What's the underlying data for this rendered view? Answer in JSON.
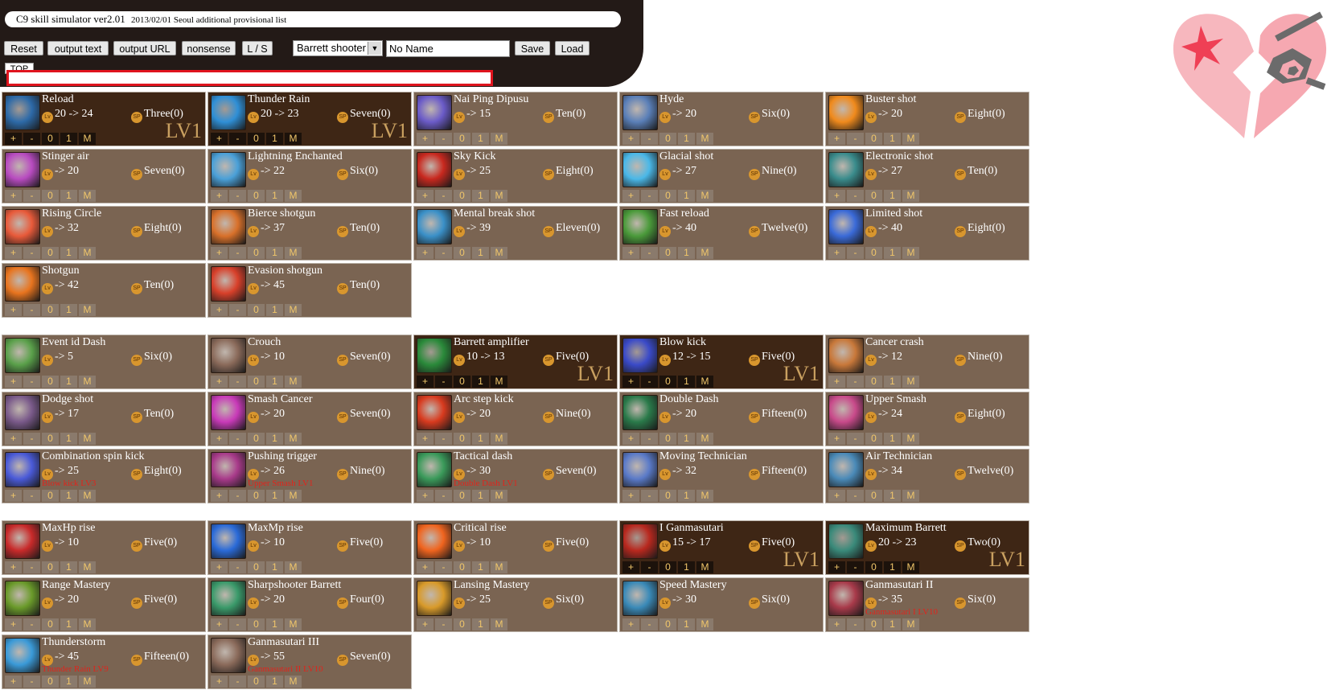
{
  "header": {
    "title": "C9 skill simulator ver2.01",
    "subtitle": "2013/02/01 Seoul additional provisional list",
    "buttons": [
      "Reset",
      "output text",
      "output URL",
      "nonsense",
      "L / S"
    ],
    "character_select": "Barrett shooter",
    "name_input": "No Name",
    "save_label": "Save",
    "load_label": "Load",
    "top_label": "TOP",
    "url_value": ""
  },
  "labels": {
    "lv_badge": "Lv",
    "sp_badge": "SP",
    "learned_marker": "LV1",
    "controls": [
      "+",
      "-",
      "0",
      "1",
      "M"
    ]
  },
  "colors": {
    "card_bg": "#7a6452",
    "card_learned_bg": "#3e2615",
    "header_bg": "#231a17",
    "prereq": "#e0241c",
    "control_text": "#f0c66a"
  },
  "skills": [
    {
      "name": "Reload",
      "level": "20 -> 24",
      "sp": "Three(0)",
      "learned": true,
      "prereq": "",
      "icon": "#2d6aa8"
    },
    {
      "name": "Thunder Rain",
      "level": "20 -> 23",
      "sp": "Seven(0)",
      "learned": true,
      "prereq": "",
      "icon": "#2f8fd6"
    },
    {
      "name": "Nai Ping Dipusu",
      "level": "-> 15",
      "sp": "Ten(0)",
      "learned": false,
      "prereq": "",
      "icon": "#6b5bc8"
    },
    {
      "name": "Hyde",
      "level": "-> 20",
      "sp": "Six(0)",
      "learned": false,
      "prereq": "",
      "icon": "#5a7fb8"
    },
    {
      "name": "Buster shot",
      "level": "-> 20",
      "sp": "Eight(0)",
      "learned": false,
      "prereq": "",
      "icon": "#f08a1c"
    },
    {
      "name": "Stinger air",
      "level": "-> 20",
      "sp": "Seven(0)",
      "learned": false,
      "prereq": "",
      "icon": "#b84bc0"
    },
    {
      "name": "Lightning Enchanted",
      "level": "-> 22",
      "sp": "Six(0)",
      "learned": false,
      "prereq": "",
      "icon": "#4aa0d8"
    },
    {
      "name": "Sky Kick",
      "level": "-> 25",
      "sp": "Eight(0)",
      "learned": false,
      "prereq": "",
      "icon": "#c8281e"
    },
    {
      "name": "Glacial shot",
      "level": "-> 27",
      "sp": "Nine(0)",
      "learned": false,
      "prereq": "",
      "icon": "#4ab8e8"
    },
    {
      "name": "Electronic shot",
      "level": "-> 27",
      "sp": "Ten(0)",
      "learned": false,
      "prereq": "",
      "icon": "#3a8c8c"
    },
    {
      "name": "Rising Circle",
      "level": "-> 32",
      "sp": "Eight(0)",
      "learned": false,
      "prereq": "",
      "icon": "#e85a3a"
    },
    {
      "name": "Bierce shotgun",
      "level": "-> 37",
      "sp": "Ten(0)",
      "learned": false,
      "prereq": "",
      "icon": "#d8702a"
    },
    {
      "name": "Mental break shot",
      "level": "-> 39",
      "sp": "Eleven(0)",
      "learned": false,
      "prereq": "",
      "icon": "#3a90c8"
    },
    {
      "name": "Fast reload",
      "level": "-> 40",
      "sp": "Twelve(0)",
      "learned": false,
      "prereq": "",
      "icon": "#4a9a3a"
    },
    {
      "name": "Limited shot",
      "level": "-> 40",
      "sp": "Eight(0)",
      "learned": false,
      "prereq": "",
      "icon": "#3a6ad8"
    },
    {
      "name": "Shotgun",
      "level": "-> 42",
      "sp": "Ten(0)",
      "learned": false,
      "prereq": "",
      "icon": "#e8741e"
    },
    {
      "name": "Evasion shotgun",
      "level": "-> 45",
      "sp": "Ten(0)",
      "learned": false,
      "prereq": "",
      "icon": "#d8402a"
    },
    {
      "name": "Event id Dash",
      "level": "-> 5",
      "sp": "Six(0)",
      "learned": false,
      "prereq": "",
      "icon": "#5aa04a"
    },
    {
      "name": "Crouch",
      "level": "-> 10",
      "sp": "Seven(0)",
      "learned": false,
      "prereq": "",
      "icon": "#8a6a5a"
    },
    {
      "name": "Barrett amplifier",
      "level": "10 -> 13",
      "sp": "Five(0)",
      "learned": true,
      "prereq": "",
      "icon": "#2a8a3a"
    },
    {
      "name": "Blow kick",
      "level": "12 -> 15",
      "sp": "Five(0)",
      "learned": true,
      "prereq": "",
      "icon": "#3a4ac8"
    },
    {
      "name": "Cancer crash",
      "level": "-> 12",
      "sp": "Nine(0)",
      "learned": false,
      "prereq": "",
      "icon": "#c8783a"
    },
    {
      "name": "Dodge shot",
      "level": "-> 17",
      "sp": "Ten(0)",
      "learned": false,
      "prereq": "",
      "icon": "#7a5a8a"
    },
    {
      "name": "Smash Cancer",
      "level": "-> 20",
      "sp": "Seven(0)",
      "learned": false,
      "prereq": "",
      "icon": "#c83ab8"
    },
    {
      "name": "Arc step kick",
      "level": "-> 20",
      "sp": "Nine(0)",
      "learned": false,
      "prereq": "",
      "icon": "#d83a1e"
    },
    {
      "name": "Double Dash",
      "level": "-> 20",
      "sp": "Fifteen(0)",
      "learned": false,
      "prereq": "",
      "icon": "#2a7a4a"
    },
    {
      "name": "Upper Smash",
      "level": "-> 24",
      "sp": "Eight(0)",
      "learned": false,
      "prereq": "",
      "icon": "#c84a8a"
    },
    {
      "name": "Combination spin kick",
      "level": "-> 25",
      "sp": "Eight(0)",
      "learned": false,
      "prereq": "Blow kick LV3",
      "icon": "#4a5ad8"
    },
    {
      "name": "Pushing trigger",
      "level": "-> 26",
      "sp": "Nine(0)",
      "learned": false,
      "prereq": "Upper Smash LV1",
      "icon": "#a83a8a"
    },
    {
      "name": "Tactical dash",
      "level": "-> 30",
      "sp": "Seven(0)",
      "learned": false,
      "prereq": "Double Dash LV1",
      "icon": "#3a9a5a"
    },
    {
      "name": "Moving Technician",
      "level": "-> 32",
      "sp": "Fifteen(0)",
      "learned": false,
      "prereq": "",
      "icon": "#5a7ac8"
    },
    {
      "name": "Air Technician",
      "level": "-> 34",
      "sp": "Twelve(0)",
      "learned": false,
      "prereq": "",
      "icon": "#4a8ab8"
    },
    {
      "name": "MaxHp rise",
      "level": "-> 10",
      "sp": "Five(0)",
      "learned": false,
      "prereq": "",
      "icon": "#c82a2a"
    },
    {
      "name": "MaxMp rise",
      "level": "-> 10",
      "sp": "Five(0)",
      "learned": false,
      "prereq": "",
      "icon": "#2a6ad8"
    },
    {
      "name": "Critical rise",
      "level": "-> 10",
      "sp": "Five(0)",
      "learned": false,
      "prereq": "",
      "icon": "#f0641e"
    },
    {
      "name": "I Ganmasutari",
      "level": "15 -> 17",
      "sp": "Five(0)",
      "learned": true,
      "prereq": "",
      "icon": "#b8281e"
    },
    {
      "name": "Maximum Barrett",
      "level": "20 -> 23",
      "sp": "Two(0)",
      "learned": true,
      "prereq": "",
      "icon": "#3a8a7a"
    },
    {
      "name": "Range Mastery",
      "level": "-> 20",
      "sp": "Five(0)",
      "learned": false,
      "prereq": "",
      "icon": "#6a9a2a"
    },
    {
      "name": "Sharpshooter Barrett",
      "level": "-> 20",
      "sp": "Four(0)",
      "learned": false,
      "prereq": "",
      "icon": "#3a9a6a"
    },
    {
      "name": "Lansing Mastery",
      "level": "-> 25",
      "sp": "Six(0)",
      "learned": false,
      "prereq": "",
      "icon": "#d89a2a"
    },
    {
      "name": "Speed Mastery",
      "level": "-> 30",
      "sp": "Six(0)",
      "learned": false,
      "prereq": "",
      "icon": "#3a8ab8"
    },
    {
      "name": "Ganmasutari II",
      "level": "-> 35",
      "sp": "Six(0)",
      "learned": false,
      "prereq": "Ganmasutari I LV10",
      "icon": "#a83a4a"
    },
    {
      "name": "Thunderstorm",
      "level": "-> 45",
      "sp": "Fifteen(0)",
      "learned": false,
      "prereq": "Thunder Rain LV9",
      "icon": "#3a9ad8"
    },
    {
      "name": "Ganmasutari III",
      "level": "-> 55",
      "sp": "Seven(0)",
      "learned": false,
      "prereq": "Ganmasutari II LV10",
      "icon": "#8a6a5a"
    }
  ]
}
